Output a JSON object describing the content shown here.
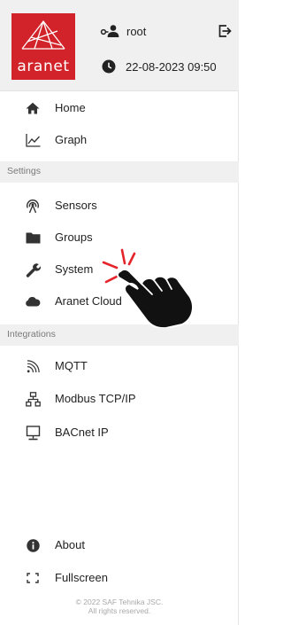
{
  "header": {
    "logo_text": "aranet",
    "username": "root",
    "datetime": "22-08-2023 09:50"
  },
  "menu": {
    "home": "Home",
    "graph": "Graph"
  },
  "sections": {
    "settings": "Settings",
    "integrations": "Integrations"
  },
  "settings_items": {
    "sensors": "Sensors",
    "groups": "Groups",
    "system": "System",
    "cloud": "Aranet Cloud"
  },
  "integration_items": {
    "mqtt": "MQTT",
    "modbus": "Modbus TCP/IP",
    "bacnet": "BACnet IP"
  },
  "bottom_items": {
    "about": "About",
    "fullscreen": "Fullscreen"
  },
  "footer": {
    "line1": "© 2022 SAF Tehnika JSC.",
    "line2": "All rights reserved."
  },
  "colors": {
    "brand_red": "#d2232a",
    "section_bg": "#f0f0f0",
    "icon": "#333333"
  },
  "icons": {
    "home": "home-icon",
    "graph": "line-chart-icon",
    "sensors": "wireless-sensor-icon",
    "groups": "folder-icon",
    "system": "wrench-icon",
    "cloud": "cloud-icon",
    "mqtt": "rss-feed-icon",
    "modbus": "network-tree-icon",
    "bacnet": "monitor-icon",
    "about": "info-icon",
    "fullscreen": "fullscreen-icon"
  }
}
